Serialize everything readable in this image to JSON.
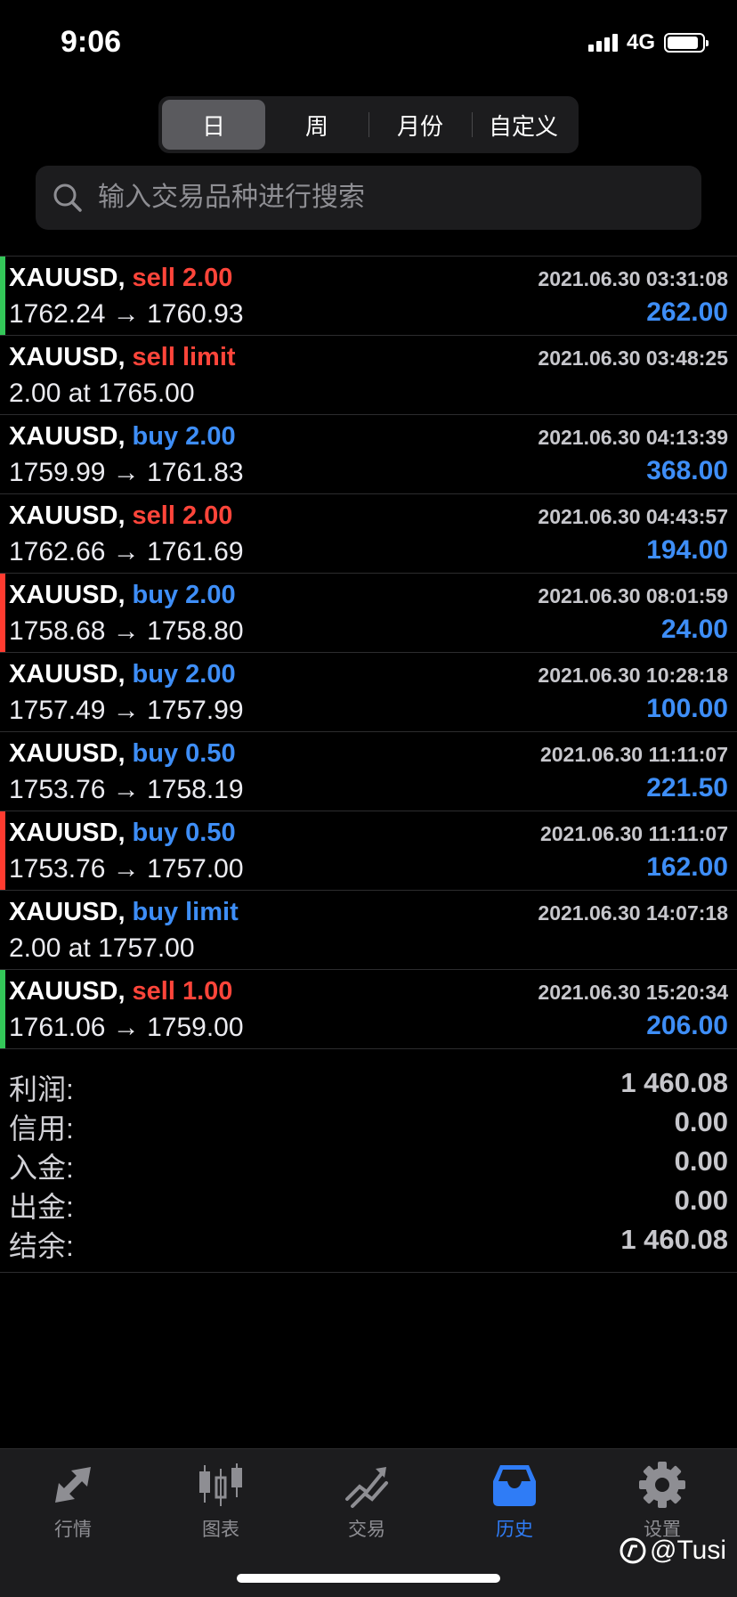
{
  "status": {
    "time": "9:06",
    "network": "4G"
  },
  "segments": [
    "日",
    "周",
    "月份",
    "自定义"
  ],
  "search": {
    "placeholder": "输入交易品种进行搜索"
  },
  "trades": [
    {
      "symbol": "XAUUSD,",
      "side": "sell 2.00",
      "side_type": "sell",
      "prices": "1762.24 → 1760.93",
      "datetime": "2021.06.30 03:31:08",
      "profit": "262.00",
      "marker": "green"
    },
    {
      "symbol": "XAUUSD,",
      "side": "sell limit",
      "side_type": "sell",
      "prices": "2.00 at 1765.00",
      "datetime": "2021.06.30 03:48:25",
      "profit": "",
      "marker": ""
    },
    {
      "symbol": "XAUUSD,",
      "side": "buy 2.00",
      "side_type": "buy",
      "prices": "1759.99 → 1761.83",
      "datetime": "2021.06.30 04:13:39",
      "profit": "368.00",
      "marker": ""
    },
    {
      "symbol": "XAUUSD,",
      "side": "sell 2.00",
      "side_type": "sell",
      "prices": "1762.66 → 1761.69",
      "datetime": "2021.06.30 04:43:57",
      "profit": "194.00",
      "marker": ""
    },
    {
      "symbol": "XAUUSD,",
      "side": "buy 2.00",
      "side_type": "buy",
      "prices": "1758.68 → 1758.80",
      "datetime": "2021.06.30 08:01:59",
      "profit": "24.00",
      "marker": "red"
    },
    {
      "symbol": "XAUUSD,",
      "side": "buy 2.00",
      "side_type": "buy",
      "prices": "1757.49 → 1757.99",
      "datetime": "2021.06.30 10:28:18",
      "profit": "100.00",
      "marker": ""
    },
    {
      "symbol": "XAUUSD,",
      "side": "buy 0.50",
      "side_type": "buy",
      "prices": "1753.76 → 1758.19",
      "datetime": "2021.06.30 11:11:07",
      "profit": "221.50",
      "marker": ""
    },
    {
      "symbol": "XAUUSD,",
      "side": "buy 0.50",
      "side_type": "buy",
      "prices": "1753.76 → 1757.00",
      "datetime": "2021.06.30 11:11:07",
      "profit": "162.00",
      "marker": "red"
    },
    {
      "symbol": "XAUUSD,",
      "side": "buy limit",
      "side_type": "buy",
      "prices": "2.00 at 1757.00",
      "datetime": "2021.06.30 14:07:18",
      "profit": "",
      "marker": ""
    },
    {
      "symbol": "XAUUSD,",
      "side": "sell 1.00",
      "side_type": "sell",
      "prices": "1761.06 → 1759.00",
      "datetime": "2021.06.30 15:20:34",
      "profit": "206.00",
      "marker": "green"
    }
  ],
  "summary": [
    {
      "label": "利润:",
      "value": "1 460.08"
    },
    {
      "label": "信用:",
      "value": "0.00"
    },
    {
      "label": "入金:",
      "value": "0.00"
    },
    {
      "label": "出金:",
      "value": "0.00"
    },
    {
      "label": "结余:",
      "value": "1 460.08"
    }
  ],
  "tabs": [
    {
      "label": "行情",
      "icon": "quotes-arrows-icon",
      "active": false
    },
    {
      "label": "图表",
      "icon": "candlestick-chart-icon",
      "active": false
    },
    {
      "label": "交易",
      "icon": "trade-trend-icon",
      "active": false
    },
    {
      "label": "历史",
      "icon": "history-inbox-icon",
      "active": true
    },
    {
      "label": "设置",
      "icon": "gear-icon",
      "active": false
    }
  ],
  "watermark": "@Tusi",
  "colors": {
    "sell": "#ff453a",
    "buy": "#3e8ef7",
    "active_tab": "#2f7cf6",
    "marker_green": "#34c759",
    "marker_red": "#ff3b30"
  }
}
